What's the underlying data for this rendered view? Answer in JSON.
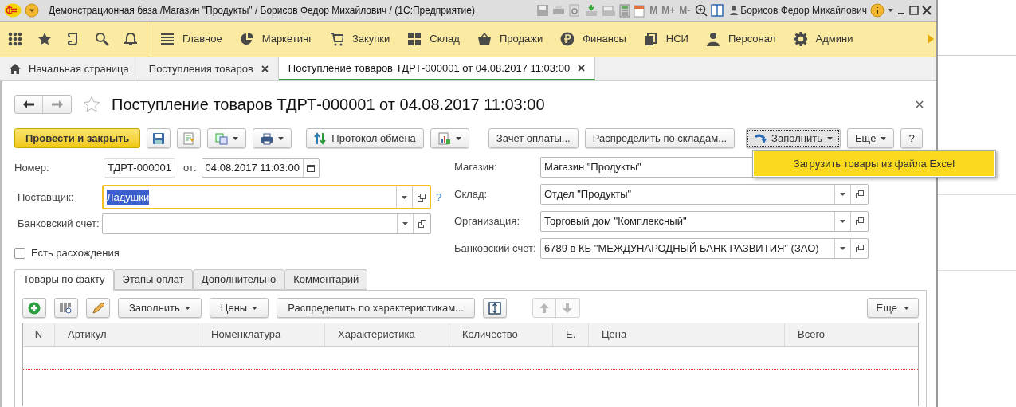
{
  "window": {
    "title": "Демонстрационная база /Магазин \"Продукты\" / Борисов Федор Михайлович /  (1С:Предприятие)",
    "memory_buttons": [
      "M",
      "M+",
      "M-"
    ],
    "user": "Борисов Федор Михайлович"
  },
  "sections": [
    {
      "label": "Главное"
    },
    {
      "label": "Маркетинг"
    },
    {
      "label": "Закупки"
    },
    {
      "label": "Склад"
    },
    {
      "label": "Продажи"
    },
    {
      "label": "Финансы"
    },
    {
      "label": "НСИ"
    },
    {
      "label": "Персонал"
    },
    {
      "label": "Админи"
    }
  ],
  "open_tabs": [
    {
      "label": "Начальная страница",
      "selected": false,
      "closable": false
    },
    {
      "label": "Поступления товаров",
      "selected": false,
      "closable": true
    },
    {
      "label": "Поступление товаров ТДРТ-000001 от 04.08.2017 11:03:00",
      "selected": true,
      "closable": true
    }
  ],
  "document": {
    "title": "Поступление товаров ТДРТ-000001 от 04.08.2017 11:03:00"
  },
  "command_bar": [
    {
      "kind": "primary",
      "label": "Провести и закрыть",
      "pressed": false
    },
    {
      "kind": "icon",
      "pressed": false
    },
    {
      "kind": "icon",
      "pressed": false
    },
    {
      "kind": "icon_menu",
      "pressed": false
    },
    {
      "kind": "icon_menu",
      "pressed": false
    },
    {
      "kind": "icon_text",
      "label": "Протокол обмена",
      "pressed": false
    },
    {
      "kind": "icon_menu",
      "pressed": false
    },
    {
      "kind": "text",
      "label": "Зачет оплаты...",
      "pressed": false
    },
    {
      "kind": "text",
      "label": "Распределить по складам...",
      "pressed": false
    },
    {
      "kind": "icon_text_menu",
      "label": "Заполнить",
      "pressed": true
    },
    {
      "kind": "text_menu",
      "label": "Еще",
      "pressed": false
    },
    {
      "kind": "text",
      "label": "?",
      "pressed": false
    }
  ],
  "fill_menu": {
    "items": [
      {
        "label": "Загрузить товары из файла Excel",
        "selected": true
      }
    ]
  },
  "header_left": {
    "number_label": "Номер:",
    "number": "ТДРТ-000001",
    "date_label": "от:",
    "date": "04.08.2017 11:03:00"
  },
  "left_fields": [
    {
      "label": "Поставщик:",
      "value": "Ладушки",
      "focused": true,
      "text_selected": true,
      "hint": "?"
    },
    {
      "label": "Банковский счет:",
      "focused": false
    }
  ],
  "discrepancies": {
    "label": "Есть расхождения",
    "checked": false
  },
  "right_fields": [
    {
      "label": "Магазин:",
      "value": "Магазин \"Продукты\"",
      "kind": "covered"
    },
    {
      "label": "Склад:",
      "value": "Отдел \"Продукты\"",
      "kind": "select"
    },
    {
      "label": "Организация:",
      "value": "Торговый дом \"Комплексный\"",
      "kind": "select"
    },
    {
      "label": "Банковский счет:",
      "value": "6789 в КБ \"МЕЖДУНАРОДНЫЙ БАНК РАЗВИТИЯ\" (ЗАО)",
      "kind": "select"
    }
  ],
  "inner_tabs": [
    {
      "label": "Товары по факту",
      "selected": true
    },
    {
      "label": "Этапы оплат",
      "selected": false
    },
    {
      "label": "Дополнительно",
      "selected": false
    },
    {
      "label": "Комментарий",
      "selected": false
    }
  ],
  "table_toolbar": [
    {
      "kind": "icon"
    },
    {
      "kind": "icon"
    },
    {
      "kind": "icon"
    },
    {
      "kind": "text_menu",
      "label": "Заполнить"
    },
    {
      "kind": "text_menu",
      "label": "Цены"
    },
    {
      "kind": "text",
      "label": "Распределить по характеристикам..."
    },
    {
      "kind": "icon"
    },
    {
      "kind": "arrows"
    }
  ],
  "table_more": "Еще",
  "table": {
    "columns": [
      "N",
      "Артикул",
      "Номенклатура",
      "Характеристика",
      "Количество",
      "Е.",
      "Цена",
      "Всего"
    ]
  }
}
